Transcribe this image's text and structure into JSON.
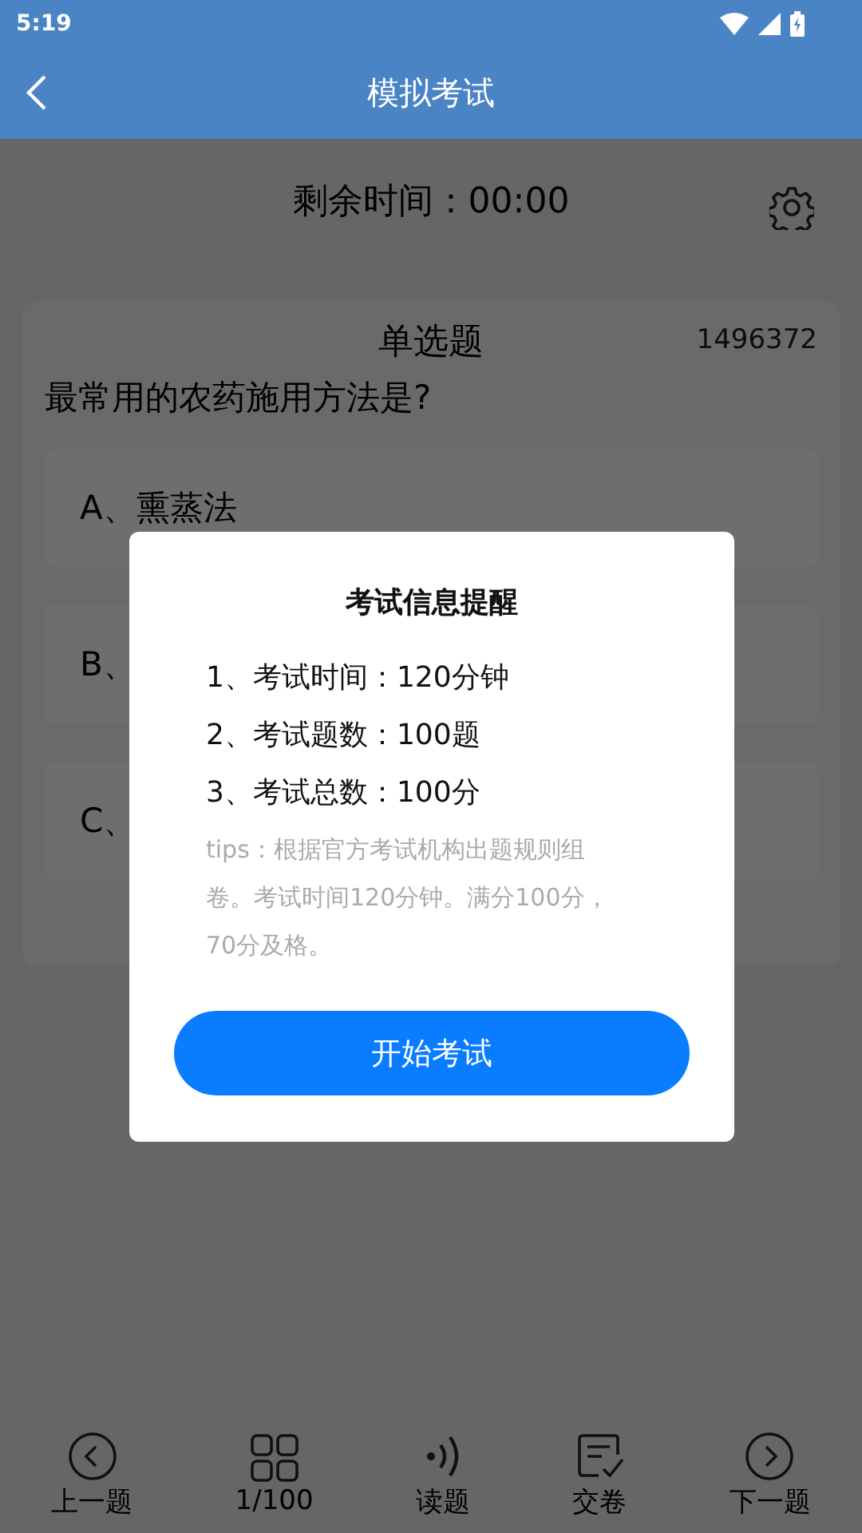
{
  "status_bar": {
    "time": "5:19"
  },
  "app_bar": {
    "title": "模拟考试"
  },
  "timer": {
    "label": "剩余时间：00:00"
  },
  "question": {
    "type": "单选题",
    "id": "1496372",
    "text": "最常用的农药施用方法是?"
  },
  "options": [
    {
      "label": "A、",
      "text": "熏蒸法"
    },
    {
      "label": "B、"
    },
    {
      "label": "C、"
    }
  ],
  "dialog": {
    "title": "考试信息提醒",
    "items": [
      "1、考试时间：120分钟",
      "2、考试题数：100题",
      "3、考试总数：100分"
    ],
    "tips": "tips：根据官方考试机构出题规则组卷。考试时间120分钟。满分100分，70分及格。",
    "button": "开始考试"
  },
  "bottom_nav": [
    {
      "kind": "prev",
      "label": "上一题"
    },
    {
      "kind": "grid",
      "label": "1/100"
    },
    {
      "kind": "read",
      "label": "读题"
    },
    {
      "kind": "submit",
      "label": "交卷"
    },
    {
      "kind": "next",
      "label": "下一题"
    }
  ]
}
